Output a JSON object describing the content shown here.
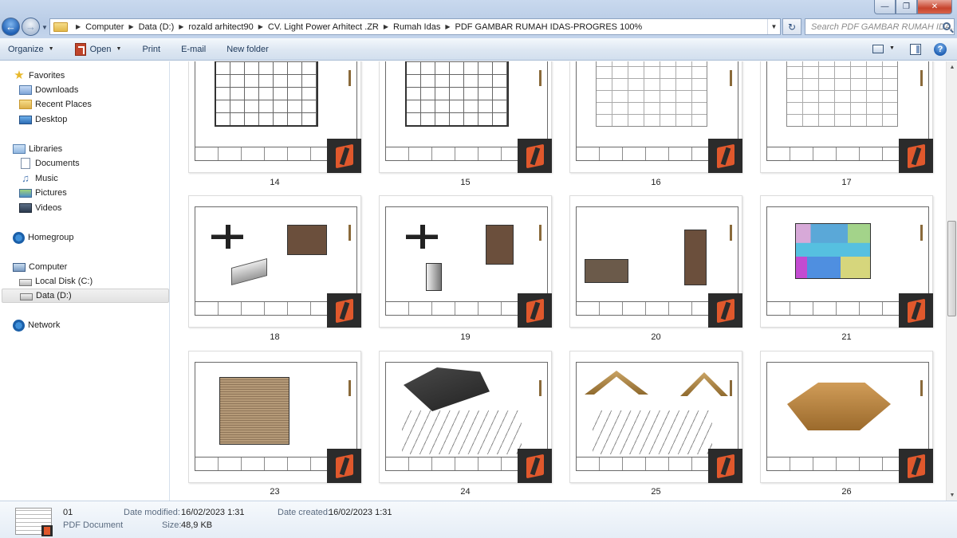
{
  "window": {
    "minimize_glyph": "—",
    "maximize_glyph": "❐",
    "close_glyph": "✕"
  },
  "address": {
    "crumbs": [
      "Computer",
      "Data (D:)",
      "rozald arhitect90",
      "CV. Light Power Arhitect .ZR",
      "Rumah Idas",
      "PDF GAMBAR RUMAH IDAS-PROGRES 100%"
    ],
    "search_placeholder": "Search PDF GAMBAR RUMAH IDA..."
  },
  "toolbar": {
    "organize": "Organize",
    "open": "Open",
    "print": "Print",
    "email": "E-mail",
    "new_folder": "New folder"
  },
  "nav": {
    "favorites": "Favorites",
    "downloads": "Downloads",
    "recent_places": "Recent Places",
    "desktop": "Desktop",
    "libraries": "Libraries",
    "documents": "Documents",
    "music": "Music",
    "pictures": "Pictures",
    "videos": "Videos",
    "homegroup": "Homegroup",
    "computer": "Computer",
    "local_disk": "Local Disk (C:)",
    "data_disk": "Data (D:)",
    "network": "Network"
  },
  "files": {
    "row1": [
      "14",
      "15",
      "16",
      "17"
    ],
    "row2": [
      "18",
      "19",
      "20",
      "21"
    ],
    "row3": [
      "23",
      "24",
      "25",
      "26"
    ]
  },
  "details": {
    "name": "01",
    "type": "PDF Document",
    "date_modified_label": "Date modified:",
    "date_modified": "16/02/2023 1:31",
    "size_label": "Size:",
    "size": "48,9 KB",
    "date_created_label": "Date created:",
    "date_created": "16/02/2023 1:31"
  },
  "colors": {
    "accent": "#1f5fb3",
    "logo_orange": "#e0582c"
  }
}
